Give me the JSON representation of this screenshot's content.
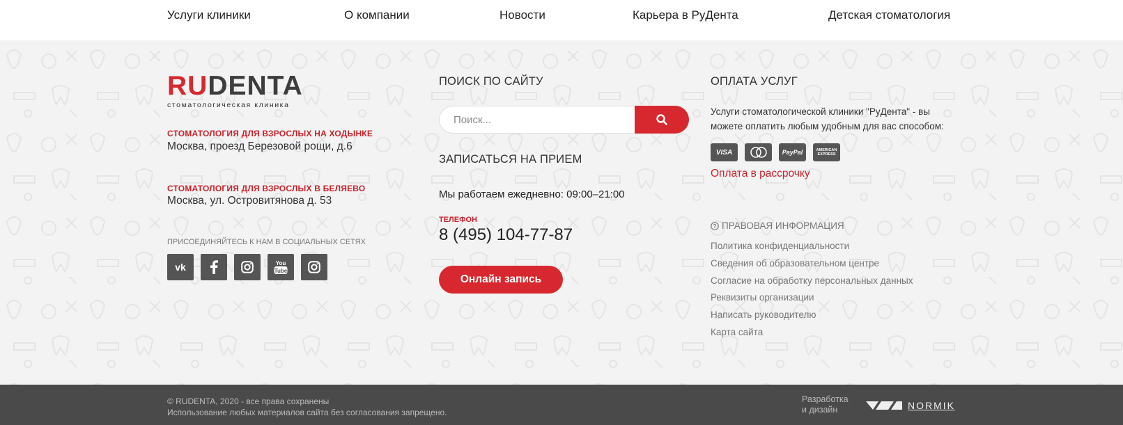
{
  "nav": {
    "items": [
      {
        "label": "Услуги клиники"
      },
      {
        "label": "О компании"
      },
      {
        "label": "Новости"
      },
      {
        "label": "Карьера в РуДента"
      },
      {
        "label": "Детская стоматология"
      }
    ]
  },
  "logo": {
    "ru": "RU",
    "denta": "DENTA",
    "subtitle": "стоматологическая клиника"
  },
  "clinics": [
    {
      "title": "СТОМАТОЛОГИЯ ДЛЯ ВЗРОСЛЫХ НА ХОДЫНКЕ",
      "address": "Москва, проезд Березовой рощи, д.6"
    },
    {
      "title": "СТОМАТОЛОГИЯ ДЛЯ ВЗРОСЛЫХ В БЕЛЯЕВО",
      "address": "Москва, ул. Островитянова д. 53"
    }
  ],
  "social": {
    "title": "ПРИСОЕДИНЯЙТЕСЬ К НАМ В СОЦИАЛЬНЫХ СЕТЯХ",
    "icons": [
      "vk-icon",
      "facebook-icon",
      "instagram-icon",
      "youtube-icon",
      "instagram-icon"
    ]
  },
  "search": {
    "heading": "ПОИСК ПО САЙТУ",
    "placeholder": "Поиск..."
  },
  "booking": {
    "heading": "ЗАПИСАТЬСЯ НА ПРИЕМ",
    "hours": "Мы работаем ежедневно: 09:00–21:00",
    "phone_label": "ТЕЛЕФОН",
    "phone": "8 (495) 104-77-87",
    "button_label": "Онлайн запись"
  },
  "payment": {
    "heading": "ОПЛАТА УСЛУГ",
    "text": "Услуги стоматологической клиники \"РуДента\" - вы можете оплатить любым удобным для вас способом:",
    "cards": {
      "visa": "VISA",
      "paypal": "PayPal",
      "amex": "AMERICAN EXPRESS"
    },
    "installment": "Оплата в рассрочку"
  },
  "legal": {
    "heading": "ПРАВОВАЯ ИНФОРМАЦИЯ",
    "links": [
      {
        "label": "Политика конфиденциальности"
      },
      {
        "label": "Сведения об образовательном центре"
      },
      {
        "label": "Согласие на обработку персональных данных"
      },
      {
        "label": "Реквизиты организации"
      },
      {
        "label": "Написать руководителю"
      },
      {
        "label": "Карта сайта"
      }
    ]
  },
  "bottom": {
    "copyright": "© RUDENTA, 2020 - все права сохранены",
    "notice": "Использование любых материалов сайта без согласования запрещено.",
    "dev_line1": "Разработка",
    "dev_line2": "и дизайн",
    "dev_company": "NORMIK"
  },
  "colors": {
    "accent": "#d8282f",
    "footer_bg": "#f3f3f3",
    "bottom_bg": "#4a4a4a",
    "icon_bg": "#555555"
  }
}
